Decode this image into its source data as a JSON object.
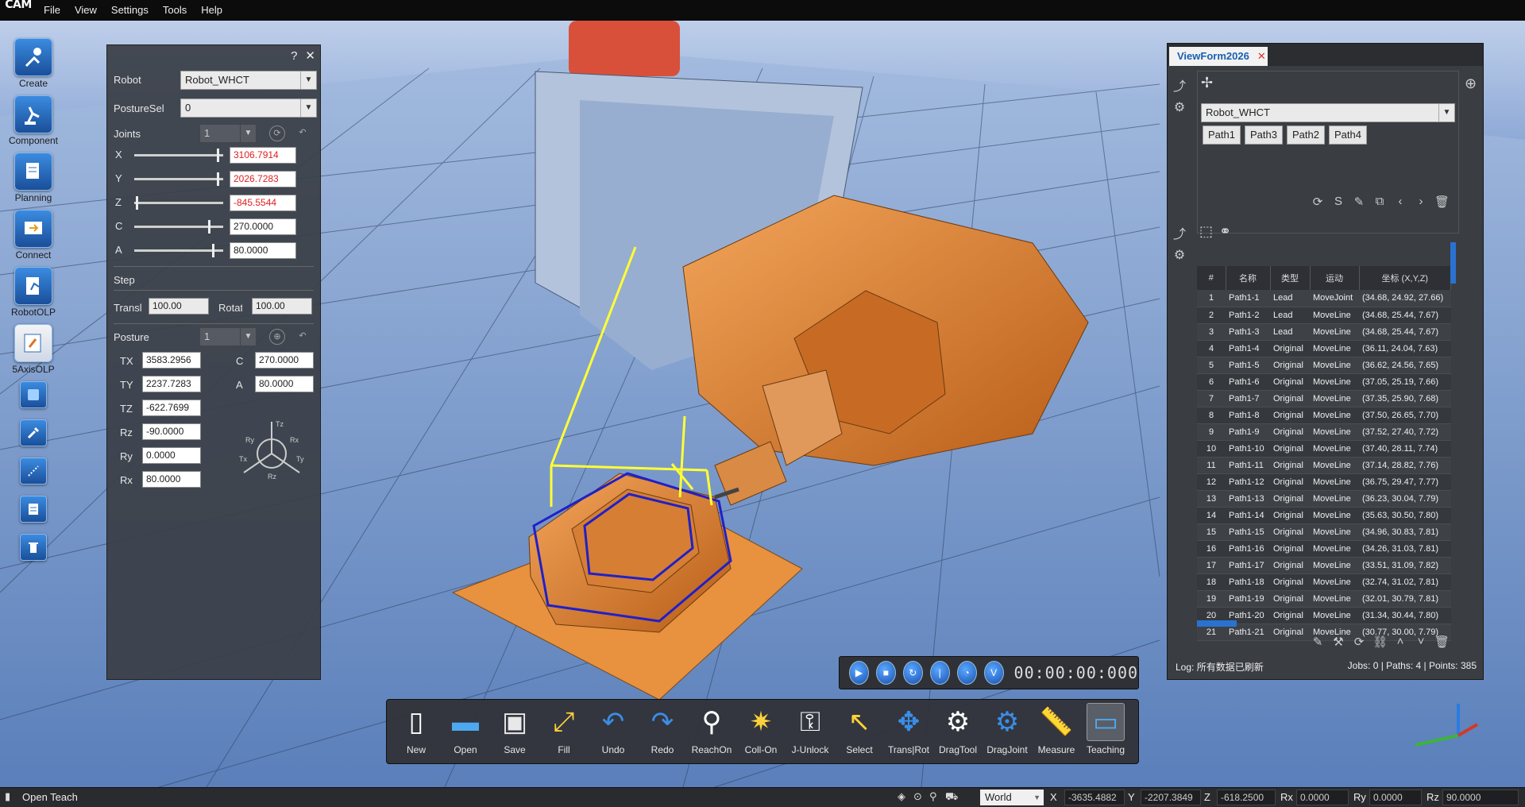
{
  "app": {
    "logo": "CAM"
  },
  "menu": [
    "File",
    "View",
    "Settings",
    "Tools",
    "Help"
  ],
  "left_toolbar": [
    {
      "label": "Create",
      "icon": "create-icon"
    },
    {
      "label": "Component",
      "icon": "component-icon"
    },
    {
      "label": "Planning",
      "icon": "planning-icon"
    },
    {
      "label": "Connect",
      "icon": "connect-icon"
    },
    {
      "label": "RobotOLP",
      "icon": "robotolp-icon"
    },
    {
      "label": "5AxisOLP",
      "icon": "5axisolp-icon"
    }
  ],
  "left_panel": {
    "robot_label": "Robot",
    "robot_value": "Robot_WHCT",
    "posturesel_label": "PostureSel",
    "posturesel_value": "0",
    "joints_label": "Joints",
    "joints_value": "1",
    "axes": [
      {
        "name": "X",
        "value": "3106.7914",
        "red": true,
        "level": 0.95
      },
      {
        "name": "Y",
        "value": "2026.7283",
        "red": true,
        "level": 0.95
      },
      {
        "name": "Z",
        "value": "-845.5544",
        "red": true,
        "level": 0.02
      },
      {
        "name": "C",
        "value": "270.0000",
        "red": false,
        "level": 0.85
      },
      {
        "name": "A",
        "value": "80.0000",
        "red": false,
        "level": 0.9
      }
    ],
    "step_label": "Step",
    "transl_label": "Transl",
    "transl_value": "100.00",
    "rotate_label": "Rotate",
    "rotate_value": "100.00",
    "posture_label": "Posture",
    "posture_value": "1",
    "tx_label": "TX",
    "tx_value": "3583.2956",
    "ty_label": "TY",
    "ty_value": "2237.7283",
    "tz_label": "TZ",
    "tz_value": "-622.7699",
    "rz_label": "Rz",
    "rz_value": "-90.0000",
    "ry_label": "Ry",
    "ry_value": "0.0000",
    "rx_label": "Rx",
    "rx_value": "80.0000",
    "c_label": "C",
    "c_value": "270.0000",
    "a_label": "A",
    "a_value": "80.0000",
    "gizmo": {
      "tz": "Tz",
      "ry": "Ry",
      "rx": "Rx",
      "tx": "Tx",
      "ty": "Ty",
      "rz": "Rz"
    }
  },
  "right_panel": {
    "tab_title": "ViewForm2026",
    "robot_value": "Robot_WHCT",
    "paths": [
      "Path1",
      "Path3",
      "Path2",
      "Path4"
    ],
    "table_headers": [
      "#",
      "名称",
      "类型",
      "运动",
      "坐标 (X,Y,Z)"
    ],
    "rows": [
      [
        "1",
        "Path1-1",
        "Lead",
        "MoveJoint",
        "(34.68, 24.92, 27.66)"
      ],
      [
        "2",
        "Path1-2",
        "Lead",
        "MoveLine",
        "(34.68, 25.44, 7.67)"
      ],
      [
        "3",
        "Path1-3",
        "Lead",
        "MoveLine",
        "(34.68, 25.44, 7.67)"
      ],
      [
        "4",
        "Path1-4",
        "Original",
        "MoveLine",
        "(36.11, 24.04, 7.63)"
      ],
      [
        "5",
        "Path1-5",
        "Original",
        "MoveLine",
        "(36.62, 24.56, 7.65)"
      ],
      [
        "6",
        "Path1-6",
        "Original",
        "MoveLine",
        "(37.05, 25.19, 7.66)"
      ],
      [
        "7",
        "Path1-7",
        "Original",
        "MoveLine",
        "(37.35, 25.90, 7.68)"
      ],
      [
        "8",
        "Path1-8",
        "Original",
        "MoveLine",
        "(37.50, 26.65, 7.70)"
      ],
      [
        "9",
        "Path1-9",
        "Original",
        "MoveLine",
        "(37.52, 27.40, 7.72)"
      ],
      [
        "10",
        "Path1-10",
        "Original",
        "MoveLine",
        "(37.40, 28.11, 7.74)"
      ],
      [
        "11",
        "Path1-11",
        "Original",
        "MoveLine",
        "(37.14, 28.82, 7.76)"
      ],
      [
        "12",
        "Path1-12",
        "Original",
        "MoveLine",
        "(36.75, 29.47, 7.77)"
      ],
      [
        "13",
        "Path1-13",
        "Original",
        "MoveLine",
        "(36.23, 30.04, 7.79)"
      ],
      [
        "14",
        "Path1-14",
        "Original",
        "MoveLine",
        "(35.63, 30.50, 7.80)"
      ],
      [
        "15",
        "Path1-15",
        "Original",
        "MoveLine",
        "(34.96, 30.83, 7.81)"
      ],
      [
        "16",
        "Path1-16",
        "Original",
        "MoveLine",
        "(34.26, 31.03, 7.81)"
      ],
      [
        "17",
        "Path1-17",
        "Original",
        "MoveLine",
        "(33.51, 31.09, 7.82)"
      ],
      [
        "18",
        "Path1-18",
        "Original",
        "MoveLine",
        "(32.74, 31.02, 7.81)"
      ],
      [
        "19",
        "Path1-19",
        "Original",
        "MoveLine",
        "(32.01, 30.79, 7.81)"
      ],
      [
        "20",
        "Path1-20",
        "Original",
        "MoveLine",
        "(31.34, 30.44, 7.80)"
      ],
      [
        "21",
        "Path1-21",
        "Original",
        "MoveLine",
        "(30.77, 30.00, 7.79)"
      ]
    ],
    "log_text": "Log: 所有数据已刷新",
    "summary_text": "Jobs: 0 | Paths: 4 | Points: 385"
  },
  "playback": {
    "time": "00:00:00:000"
  },
  "bottom_toolbar": [
    {
      "label": "New",
      "icon": "new-file-icon"
    },
    {
      "label": "Open",
      "icon": "open-folder-icon"
    },
    {
      "label": "Save",
      "icon": "save-icon"
    },
    {
      "label": "Fill",
      "icon": "fill-icon"
    },
    {
      "label": "Undo",
      "icon": "undo-icon"
    },
    {
      "label": "Redo",
      "icon": "redo-icon"
    },
    {
      "label": "ReachOn",
      "icon": "reach-on-icon"
    },
    {
      "label": "Coll-On",
      "icon": "collision-on-icon"
    },
    {
      "label": "J-Unlock",
      "icon": "joint-unlock-icon"
    },
    {
      "label": "Select",
      "icon": "select-icon"
    },
    {
      "label": "Trans|Rot",
      "icon": "trans-rot-icon"
    },
    {
      "label": "DragTool",
      "icon": "drag-tool-icon"
    },
    {
      "label": "DragJoint",
      "icon": "drag-joint-icon"
    },
    {
      "label": "Measure",
      "icon": "measure-icon"
    },
    {
      "label": "Teaching",
      "icon": "teaching-icon"
    }
  ],
  "statusbar": {
    "message": "Open Teach",
    "frame": "World",
    "x_label": "X",
    "x_value": "-3635.4882",
    "y_label": "Y",
    "y_value": "-2207.3849",
    "z_label": "Z",
    "z_value": "-618.2500",
    "rx_label": "Rx",
    "rx_value": "0.0000",
    "ry_label": "Ry",
    "ry_value": "0.0000",
    "rz_label": "Rz",
    "rz_value": "90.0000"
  },
  "colors": {
    "accent": "#1a5fb0",
    "robot": "#e2853a",
    "path": "#ffff33",
    "contour": "#2020c8",
    "red_value": "#e02020"
  }
}
